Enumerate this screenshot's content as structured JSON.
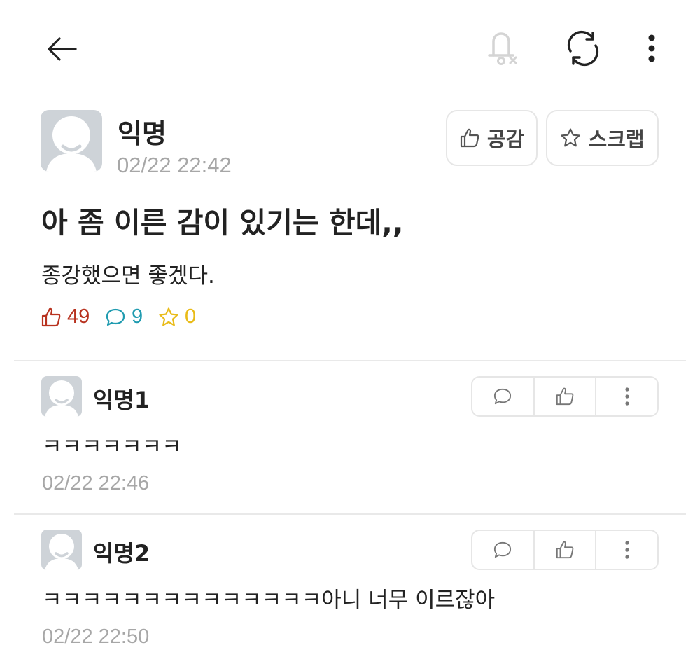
{
  "post": {
    "author": "익명",
    "date": "02/22 22:42",
    "title": "아 좀 이른 감이 있기는 한데,,",
    "body": "종강했으면 좋겠다.",
    "like_button_label": "공감",
    "scrap_button_label": "스크랩",
    "stats": {
      "likes": "49",
      "comments": "9",
      "scraps": "0"
    }
  },
  "comments": [
    {
      "author": "익명1",
      "text": "ㅋㅋㅋㅋㅋㅋㅋ",
      "date": "02/22 22:46"
    },
    {
      "author": "익명2",
      "text": "ㅋㅋㅋㅋㅋㅋㅋㅋㅋㅋㅋㅋㅋㅋ아니 너무 이르잖아",
      "date": "02/22 22:50"
    }
  ],
  "colors": {
    "like": "#b8321f",
    "comment": "#1f9bb0",
    "scrap": "#e9bb17",
    "muted": "#a7a7a7"
  },
  "icons": [
    "back-arrow-icon",
    "bell-off-icon",
    "refresh-icon",
    "more-vertical-icon",
    "thumbs-up-icon",
    "star-icon",
    "chat-bubble-icon"
  ]
}
